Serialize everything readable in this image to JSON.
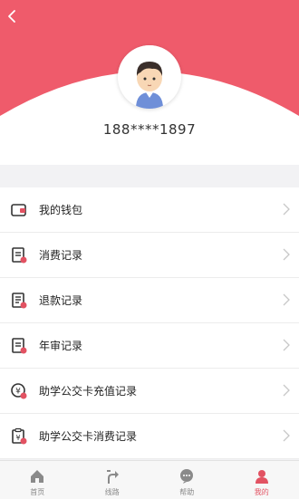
{
  "colors": {
    "accent": "#e25262",
    "header_bg": "#ef5b6b",
    "icon_gray": "#333333",
    "inactive_tab": "#8a8a8a"
  },
  "profile": {
    "phone": "188****1897"
  },
  "menu": [
    {
      "label": "我的钱包",
      "icon": "wallet-icon"
    },
    {
      "label": "消费记录",
      "icon": "consumption-record-icon"
    },
    {
      "label": "退款记录",
      "icon": "refund-record-icon"
    },
    {
      "label": "年审记录",
      "icon": "annual-review-icon"
    },
    {
      "label": "助学公交卡充值记录",
      "icon": "yuan-recharge-icon"
    },
    {
      "label": "助学公交卡消费记录",
      "icon": "clipboard-yuan-icon"
    }
  ],
  "tabbar": [
    {
      "label": "首页",
      "icon": "home-icon"
    },
    {
      "label": "线路",
      "icon": "route-icon"
    },
    {
      "label": "帮助",
      "icon": "help-icon"
    },
    {
      "label": "我的",
      "icon": "user-icon",
      "active": true
    }
  ]
}
